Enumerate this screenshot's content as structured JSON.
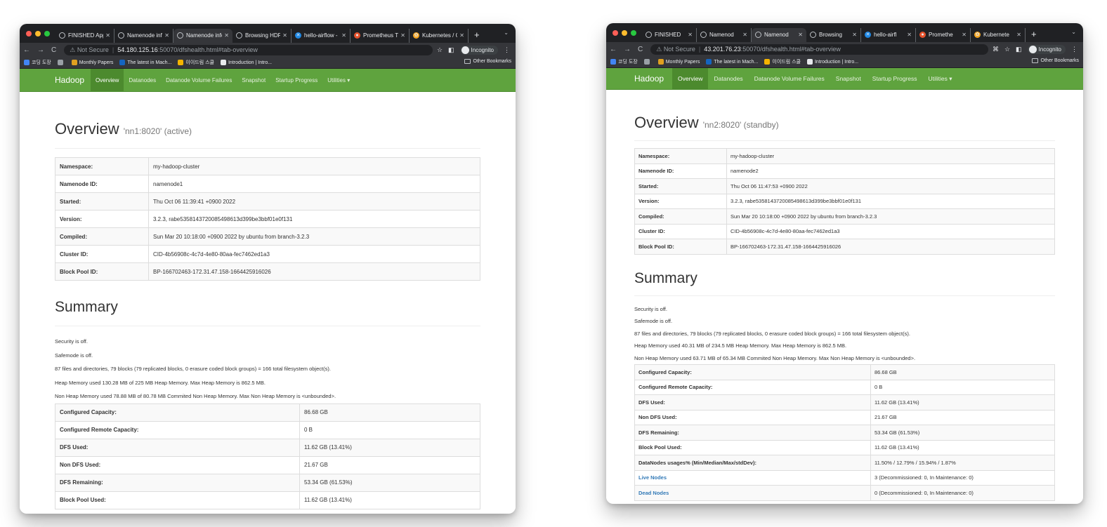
{
  "colors": {
    "accent": "#5fa33e",
    "nav_active": "#4c8a2e",
    "link": "#337ab7",
    "chrome_dark": "#202124"
  },
  "left": {
    "tabs": [
      {
        "label": "FINISHED Applic",
        "icon": "globe-icon"
      },
      {
        "label": "Namenode inform",
        "icon": "globe-icon"
      },
      {
        "label": "Namenode inform",
        "icon": "globe-icon"
      },
      {
        "label": "Browsing HDFS",
        "icon": "globe-icon"
      },
      {
        "label": "hello-airflow - Gr",
        "icon": "airflow-icon"
      },
      {
        "label": "Prometheus Time",
        "icon": "prometheus-icon"
      },
      {
        "label": "Kubernetes / Cor",
        "icon": "grafana-icon"
      }
    ],
    "address": {
      "security": "Not Secure",
      "host": "54.180.125.16",
      "rest": ":50070/dfshealth.html#tab-overview"
    },
    "incognito": "Incognito",
    "bookmarks": [
      "코딩 도장",
      "",
      "Monthly Papers",
      "The latest in Mach...",
      "이이드림 스쿨",
      "Introduction | Intro..."
    ],
    "other_bookmarks": "Other Bookmarks",
    "nav": {
      "brand": "Hadoop",
      "items": [
        "Overview",
        "Datanodes",
        "Datanode Volume Failures",
        "Snapshot",
        "Startup Progress",
        "Utilities ▾"
      ]
    },
    "overview": {
      "title": "Overview",
      "subtitle": "'nn1:8020' (active)"
    },
    "info": [
      {
        "k": "Namespace:",
        "v": "my-hadoop-cluster"
      },
      {
        "k": "Namenode ID:",
        "v": "namenode1"
      },
      {
        "k": "Started:",
        "v": "Thu Oct 06 11:39:41 +0900 2022"
      },
      {
        "k": "Version:",
        "v": "3.2.3, rabe5358143720085498613d399be3bbf01e0f131"
      },
      {
        "k": "Compiled:",
        "v": "Sun Mar 20 10:18:00 +0900 2022 by ubuntu from branch-3.2.3"
      },
      {
        "k": "Cluster ID:",
        "v": "CID-4b56908c-4c7d-4e80-80aa-fec7462ed1a3"
      },
      {
        "k": "Block Pool ID:",
        "v": "BP-166702463-172.31.47.158-1664425916026"
      }
    ],
    "summary_title": "Summary",
    "summary_lines": [
      "Security is off.",
      "Safemode is off.",
      "87 files and directories, 79 blocks (79 replicated blocks, 0 erasure coded block groups) = 166 total filesystem object(s).",
      "Heap Memory used 130.28 MB of 225 MB Heap Memory. Max Heap Memory is 862.5 MB.",
      "Non Heap Memory used 78.88 MB of 80.78 MB Commited Non Heap Memory. Max Non Heap Memory is <unbounded>."
    ],
    "summary_table": [
      {
        "k": "Configured Capacity:",
        "v": "86.68 GB"
      },
      {
        "k": "Configured Remote Capacity:",
        "v": "0 B"
      },
      {
        "k": "DFS Used:",
        "v": "11.62 GB (13.41%)"
      },
      {
        "k": "Non DFS Used:",
        "v": "21.67 GB"
      },
      {
        "k": "DFS Remaining:",
        "v": "53.34 GB (61.53%)"
      },
      {
        "k": "Block Pool Used:",
        "v": "11.62 GB (13.41%)"
      }
    ]
  },
  "right": {
    "tabs": [
      {
        "label": "FINISHED",
        "icon": "globe-icon"
      },
      {
        "label": "Namenod",
        "icon": "globe-icon"
      },
      {
        "label": "Namenod",
        "icon": "globe-icon"
      },
      {
        "label": "Browsing",
        "icon": "globe-icon"
      },
      {
        "label": "hello-airfl",
        "icon": "airflow-icon"
      },
      {
        "label": "Promethe",
        "icon": "prometheus-icon"
      },
      {
        "label": "Kubernete",
        "icon": "grafana-icon"
      }
    ],
    "address": {
      "security": "Not Secure",
      "host": "43.201.76.23",
      "rest": ":50070/dfshealth.html#tab-overview"
    },
    "incognito": "Incognito",
    "bookmarks": [
      "코딩 도장",
      "",
      "Monthly Papers",
      "The latest in Mach...",
      "이이드림 스쿨",
      "Introduction | Intro..."
    ],
    "other_bookmarks": "Other Bookmarks",
    "nav": {
      "brand": "Hadoop",
      "items": [
        "Overview",
        "Datanodes",
        "Datanode Volume Failures",
        "Snapshot",
        "Startup Progress",
        "Utilities ▾"
      ]
    },
    "overview": {
      "title": "Overview",
      "subtitle": "'nn2:8020' (standby)"
    },
    "info": [
      {
        "k": "Namespace:",
        "v": "my-hadoop-cluster"
      },
      {
        "k": "Namenode ID:",
        "v": "namenode2"
      },
      {
        "k": "Started:",
        "v": "Thu Oct 06 11:47:53 +0900 2022"
      },
      {
        "k": "Version:",
        "v": "3.2.3, rabe5358143720085498613d399be3bbf01e0f131"
      },
      {
        "k": "Compiled:",
        "v": "Sun Mar 20 10:18:00 +0900 2022 by ubuntu from branch-3.2.3"
      },
      {
        "k": "Cluster ID:",
        "v": "CID-4b56908c-4c7d-4e80-80aa-fec7462ed1a3"
      },
      {
        "k": "Block Pool ID:",
        "v": "BP-166702463-172.31.47.158-1664425916026"
      }
    ],
    "summary_title": "Summary",
    "summary_lines": [
      "Security is off.",
      "Safemode is off.",
      "87 files and directories, 79 blocks (79 replicated blocks, 0 erasure coded block groups) = 166 total filesystem object(s).",
      "Heap Memory used 40.31 MB of 234.5 MB Heap Memory. Max Heap Memory is 862.5 MB.",
      "Non Heap Memory used 63.71 MB of 65.34 MB Commited Non Heap Memory. Max Non Heap Memory is <unbounded>."
    ],
    "summary_table": [
      {
        "k": "Configured Capacity:",
        "v": "86.68 GB"
      },
      {
        "k": "Configured Remote Capacity:",
        "v": "0 B"
      },
      {
        "k": "DFS Used:",
        "v": "11.62 GB (13.41%)"
      },
      {
        "k": "Non DFS Used:",
        "v": "21.67 GB"
      },
      {
        "k": "DFS Remaining:",
        "v": "53.34 GB (61.53%)"
      },
      {
        "k": "Block Pool Used:",
        "v": "11.62 GB (13.41%)"
      },
      {
        "k": "DataNodes usages% (Min/Median/Max/stdDev):",
        "v": "11.50% / 12.79% / 15.94% / 1.87%"
      },
      {
        "k": "Live Nodes",
        "v": "3 (Decommissioned: 0, In Maintenance: 0)",
        "link": true
      },
      {
        "k": "Dead Nodes",
        "v": "0 (Decommissioned: 0, In Maintenance: 0)",
        "link": true
      }
    ]
  }
}
